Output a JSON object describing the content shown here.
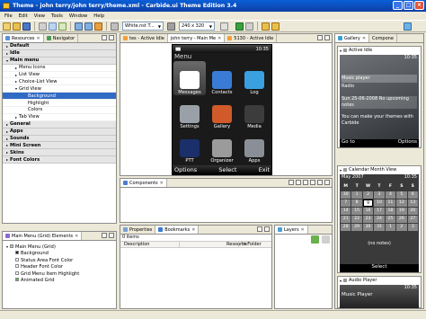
{
  "window": {
    "title": "Theme - john terry/john terry/theme.xml - Carbide.ui Theme Edition 3.4"
  },
  "menu": [
    "File",
    "Edit",
    "View",
    "Tools",
    "Window",
    "Help"
  ],
  "toolbar": {
    "theme_combo": "White.nst T...",
    "resolution_combo": "240 x 320"
  },
  "left_panel": {
    "tabs": [
      "Resources",
      "Navigator"
    ],
    "tree": [
      {
        "label": "Default",
        "group": true
      },
      {
        "label": "Idle",
        "group": true
      },
      {
        "label": "Main menu",
        "group": true,
        "open": true
      },
      {
        "label": "Menu Icons",
        "indent": 1
      },
      {
        "label": "List View",
        "indent": 1
      },
      {
        "label": "Choice-List View",
        "indent": 1
      },
      {
        "label": "Grid View",
        "indent": 1,
        "open": true
      },
      {
        "label": "Background",
        "indent": 2,
        "selected": true
      },
      {
        "label": "Highlight",
        "indent": 2
      },
      {
        "label": "Colors",
        "indent": 2
      },
      {
        "label": "Tab View",
        "indent": 1
      },
      {
        "label": "General",
        "group": true
      },
      {
        "label": "Apps",
        "group": true
      },
      {
        "label": "Sounds",
        "group": true
      },
      {
        "label": "Mini Screen",
        "group": true
      },
      {
        "label": "Skins",
        "group": true
      },
      {
        "label": "Font Colors",
        "group": true
      }
    ]
  },
  "elements_panel": {
    "tab": "Main Menu (Grid) Elements",
    "root": "Main Menu (Grid)",
    "items": [
      "Background",
      "Status Area Font Color",
      "Header Font Color",
      "Grid Menu Item Highlight",
      "Animated Grid"
    ]
  },
  "editor": {
    "tabs": [
      "tes - Active Idle",
      "john terry - Main Me",
      "5130 - Active Idle"
    ],
    "phone": {
      "header": "Menu",
      "time": "10:35",
      "items": [
        {
          "label": "Messages",
          "icon": "messages-icon",
          "color": "#ffffff"
        },
        {
          "label": "Contacts",
          "icon": "contacts-icon",
          "color": "#3a7bd5"
        },
        {
          "label": "Log",
          "icon": "log-icon",
          "color": "#3aa0e0"
        },
        {
          "label": "Settings",
          "icon": "settings-icon",
          "color": "#9aa0a8"
        },
        {
          "label": "Gallery",
          "icon": "gallery-icon",
          "color": "#d05a2a"
        },
        {
          "label": "Media",
          "icon": "media-icon",
          "color": "#3c3c3c"
        },
        {
          "label": "PTT",
          "icon": "ptt-icon",
          "color": "#1b2f6a"
        },
        {
          "label": "Organizer",
          "icon": "organizer-icon",
          "color": "#9b9b9b"
        },
        {
          "label": "Apps",
          "icon": "apps-icon",
          "color": "#8a8f97"
        }
      ],
      "softkeys": {
        "left": "Options",
        "center": "Select",
        "right": "Exit"
      }
    }
  },
  "components_panel": {
    "tab": "Components"
  },
  "bottom_panel": {
    "tabs": [
      "Properties",
      "Bookmarks"
    ],
    "summary": "0 items",
    "columns": [
      "Description",
      "Resource",
      "In Folder"
    ]
  },
  "layers_panel": {
    "tab": "Layers"
  },
  "gallery": {
    "tabs": [
      "Gallery",
      "Compone"
    ],
    "thumbs": [
      {
        "title": "Active Idle",
        "time": "10:35",
        "rows": [
          "Music player",
          "Radio",
          "Sun 25-06-2008 No upcoming notes",
          "You can make your themes with Carbide"
        ],
        "softkeys": {
          "left": "Go to",
          "right": "Options"
        }
      },
      {
        "title": "Calendar Month View",
        "month": "May 2007",
        "time": "10:35",
        "days": [
          "M",
          "T",
          "W",
          "T",
          "F",
          "S",
          "S"
        ],
        "dates": [
          "30",
          "1",
          "2",
          "3",
          "4",
          "5",
          "6",
          "7",
          "8",
          "9",
          "10",
          "11",
          "12",
          "13",
          "14",
          "15",
          "16",
          "17",
          "18",
          "19",
          "20",
          "21",
          "22",
          "23",
          "24",
          "25",
          "26",
          "27",
          "28",
          "29",
          "30",
          "31",
          "1",
          "2",
          "3"
        ],
        "today": "9",
        "note": "(no notes)",
        "softkey": "Select"
      },
      {
        "title": "Audio Player",
        "time": "10:35",
        "caption": "Music Player"
      }
    ]
  }
}
